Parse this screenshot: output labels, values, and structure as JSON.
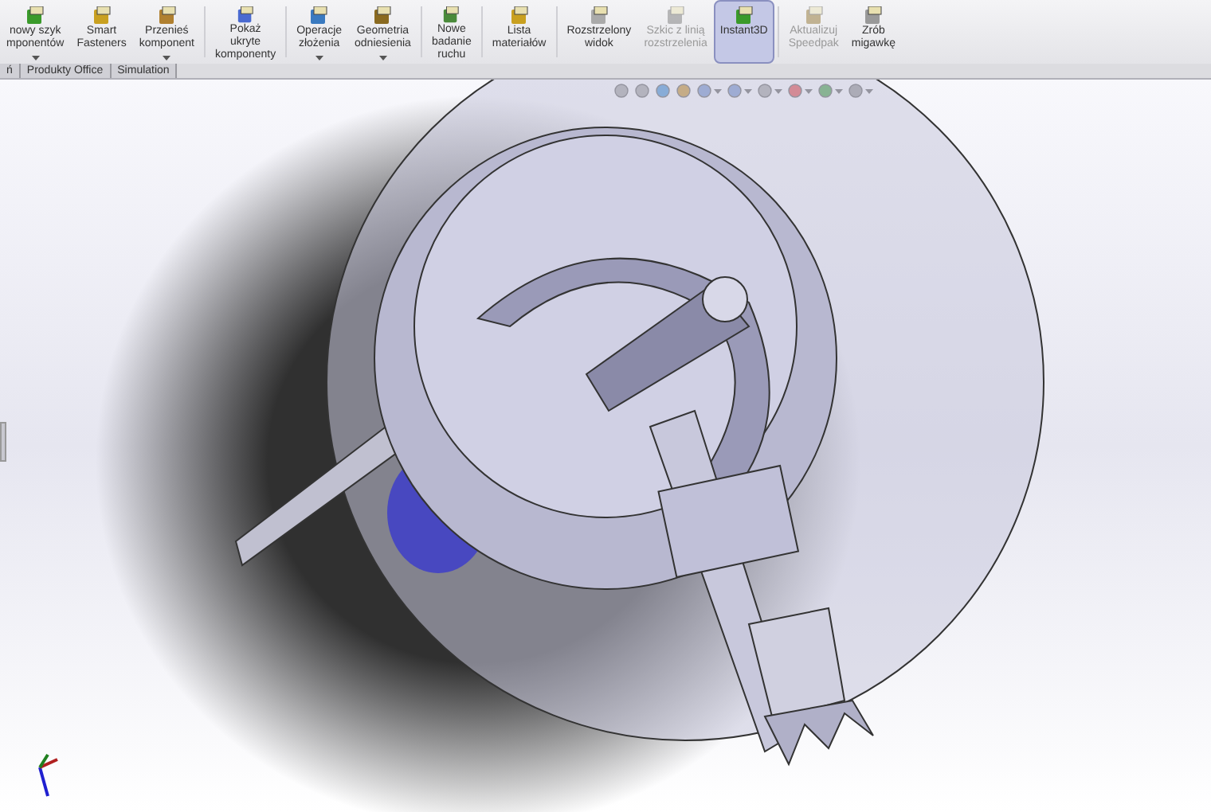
{
  "toolbar_groups": [
    {
      "buttons": [
        {
          "lines": [
            "nowy szyk",
            "mponentów"
          ],
          "dropdown": true,
          "disabled": false,
          "selected": false
        },
        {
          "lines": [
            "Smart",
            "Fasteners"
          ],
          "dropdown": false,
          "disabled": false,
          "selected": false
        },
        {
          "lines": [
            "Przenieś",
            "komponent"
          ],
          "dropdown": true,
          "disabled": false,
          "selected": false
        }
      ]
    },
    {
      "buttons": [
        {
          "lines": [
            "Pokaż",
            "ukryte",
            "komponenty"
          ],
          "dropdown": false,
          "disabled": false,
          "selected": false
        }
      ]
    },
    {
      "buttons": [
        {
          "lines": [
            "Operacje",
            "złożenia"
          ],
          "dropdown": true,
          "disabled": false,
          "selected": false
        },
        {
          "lines": [
            "Geometria",
            "odniesienia"
          ],
          "dropdown": true,
          "disabled": false,
          "selected": false
        }
      ]
    },
    {
      "buttons": [
        {
          "lines": [
            "Nowe",
            "badanie",
            "ruchu"
          ],
          "dropdown": false,
          "disabled": false,
          "selected": false
        }
      ]
    },
    {
      "buttons": [
        {
          "lines": [
            "Lista",
            "materiałów"
          ],
          "dropdown": false,
          "disabled": false,
          "selected": false
        }
      ]
    },
    {
      "buttons": [
        {
          "lines": [
            "Rozstrzelony",
            "widok"
          ],
          "dropdown": false,
          "disabled": false,
          "selected": false
        },
        {
          "lines": [
            "Szkic z linią",
            "rozstrzelenia"
          ],
          "dropdown": false,
          "disabled": true,
          "selected": false
        },
        {
          "lines": [
            "Instant3D"
          ],
          "dropdown": false,
          "disabled": false,
          "selected": true
        }
      ]
    },
    {
      "buttons": [
        {
          "lines": [
            "Aktualizuj",
            "Speedpak"
          ],
          "dropdown": false,
          "disabled": true,
          "selected": false
        },
        {
          "lines": [
            "Zrób",
            "migawkę"
          ],
          "dropdown": false,
          "disabled": false,
          "selected": false
        }
      ]
    }
  ],
  "tabs": [
    {
      "label": "ń",
      "selected": false
    },
    {
      "label": "Produkty Office",
      "selected": false
    },
    {
      "label": "Simulation",
      "selected": false
    }
  ]
}
